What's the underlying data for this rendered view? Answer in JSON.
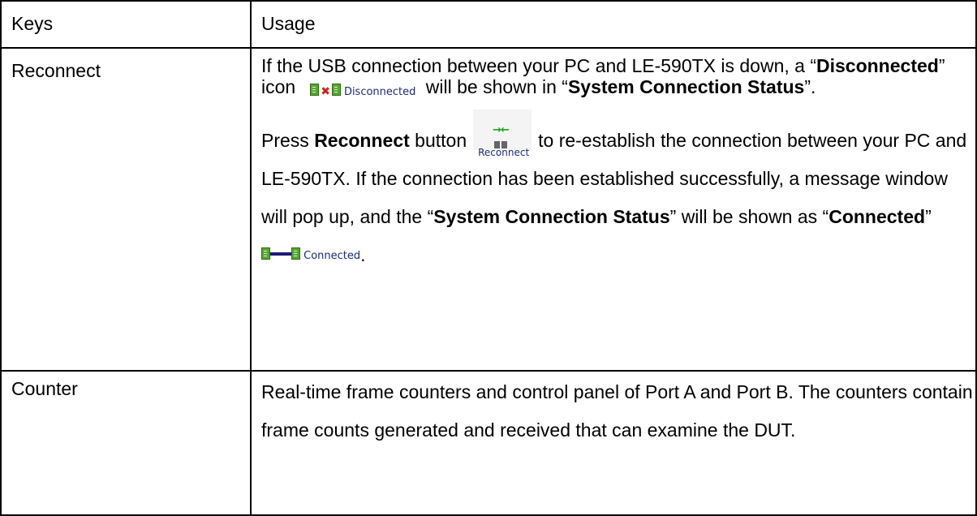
{
  "table": {
    "header": {
      "keys": "Keys",
      "usage": "Usage"
    },
    "reconnect": {
      "key": "Reconnect",
      "p1_a": "If the USB connection between your PC and LE-590TX is down, a “",
      "p1_b": "Disconnected",
      "p1_c": "” icon",
      "icon_disconnected_label": "Disconnected",
      "p1_d": "will be shown in “",
      "p1_e": "System Connection Status",
      "p1_f": "”.",
      "p2_a": "Press ",
      "p2_b": "Reconnect",
      "p2_c": " button",
      "reconnect_icon_label": "Reconnect",
      "p2_d": "to re-establish the connection between your PC and LE-590TX. If the connection has been established successfully, a message window will pop up, and the “",
      "p2_e": "System Connection Status",
      "p2_f": "” will be shown as “",
      "p2_g": "Connected",
      "p2_h": "”",
      "icon_connected_label": "Connected",
      "p2_i": "."
    },
    "counter": {
      "key": "Counter",
      "text": "Real-time frame counters and control panel of Port A and Port B. The counters contain frame counts generated and received that can examine the DUT."
    }
  },
  "icons": {
    "disconnected": "disconnected-icon",
    "reconnect": "reconnect-button-icon",
    "connected": "connected-icon"
  },
  "colors": {
    "plug_green": "#55a832",
    "x_red": "#d32020",
    "wire_blue": "#1a1a7a"
  }
}
